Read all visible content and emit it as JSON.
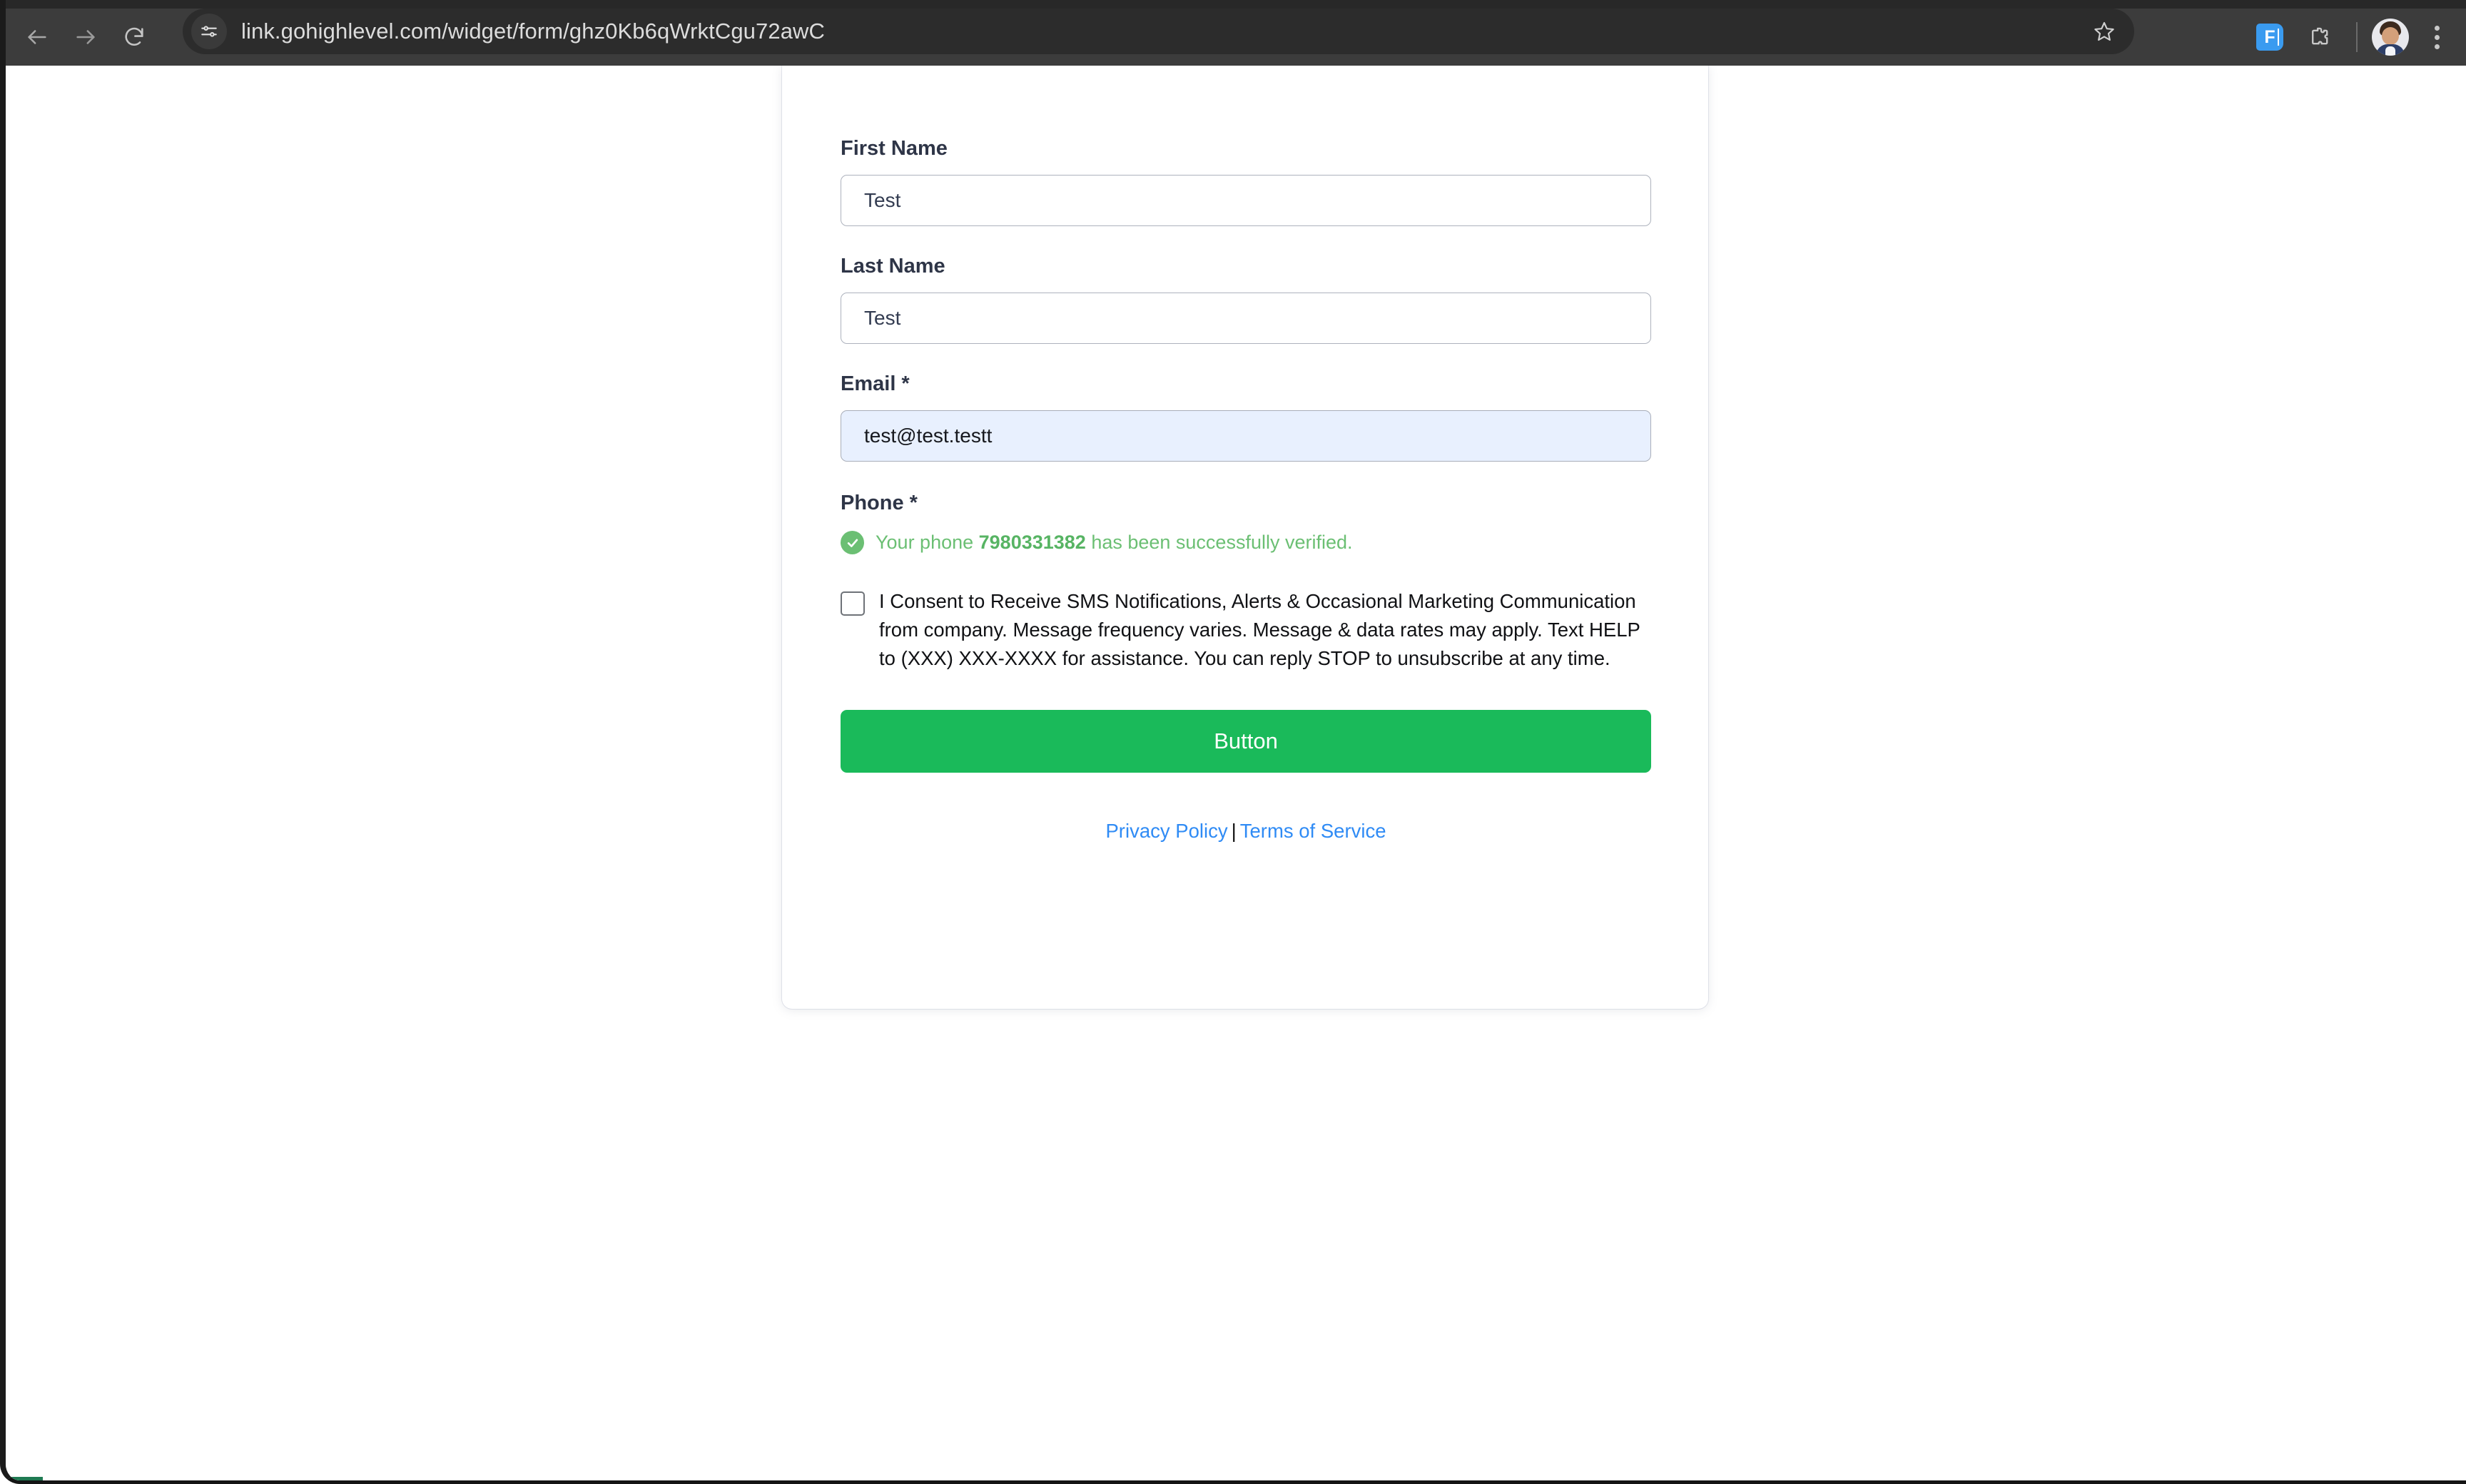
{
  "browser": {
    "url": "link.gohighlevel.com/widget/form/ghz0Kb6qWrktCgu72awC",
    "back_label": "Back",
    "forward_label": "Forward",
    "reload_label": "Reload",
    "site_settings_label": "View site information",
    "bookmark_label": "Bookmark this tab",
    "extension_label": "F",
    "extensions_label": "Extensions",
    "profile_label": "Profile",
    "menu_label": "Customize and control Google Chrome",
    "toolbar_bg": "#3c3c3c",
    "omnibox_bg": "#2c2c2c"
  },
  "form": {
    "fields": [
      {
        "label": "First Name",
        "value": "Test",
        "placeholder": "First Name",
        "autofilled": false
      },
      {
        "label": "Last Name",
        "value": "Test",
        "placeholder": "Last Name",
        "autofilled": false
      },
      {
        "label": "Email *",
        "value": "test@test.testt",
        "placeholder": "Email",
        "autofilled": true
      }
    ],
    "phone": {
      "label": "Phone *",
      "status_prefix": "Your phone ",
      "status_number": "7980331382",
      "status_suffix": " has been successfully verified.",
      "status_color": "#6bbf73"
    },
    "consent": {
      "checked": false,
      "text": "I Consent to Receive SMS Notifications, Alerts & Occasional Marketing Communication from company. Message frequency varies. Message & data rates may apply. Text HELP to (XXX) XXX-XXXX for assistance. You can reply STOP to unsubscribe at any time."
    },
    "submit": {
      "label": "Button",
      "color": "#1ABA5A",
      "text_color": "#ffffff"
    },
    "footer": {
      "privacy_label": "Privacy Policy",
      "separator": "|",
      "terms_label": "Terms of Service",
      "link_color": "#2f8bf5"
    }
  }
}
